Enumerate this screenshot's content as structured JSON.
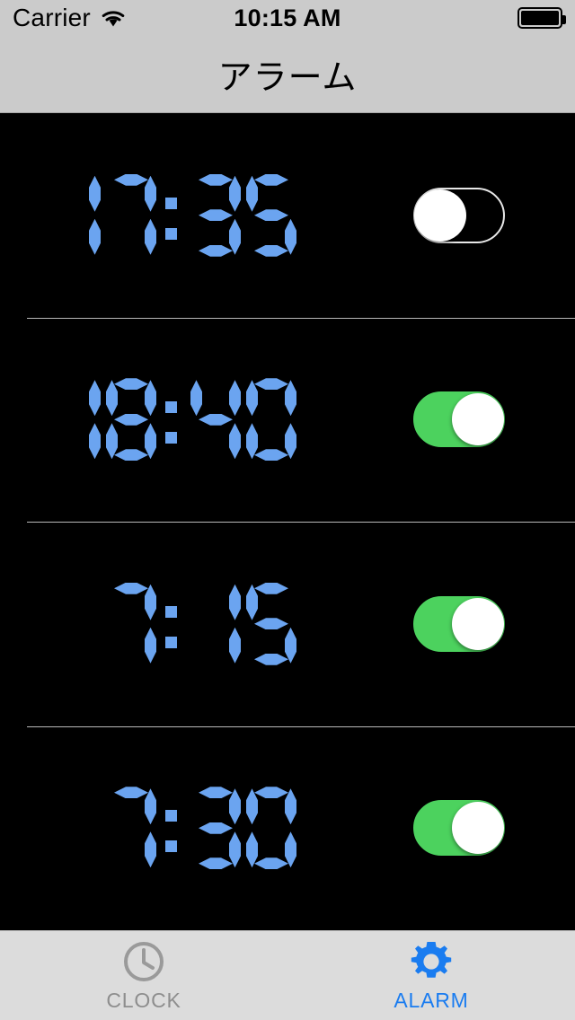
{
  "status_bar": {
    "carrier": "Carrier",
    "wifi_icon": "wifi-icon",
    "time": "10:15 AM",
    "battery_icon": "battery-full-icon"
  },
  "navbar": {
    "title": "アラーム"
  },
  "alarms": [
    {
      "time": "17:35",
      "hour": "17",
      "minute": "35",
      "enabled": false,
      "toggle_state": "off"
    },
    {
      "time": "18:40",
      "hour": "18",
      "minute": "40",
      "enabled": true,
      "toggle_state": "on"
    },
    {
      "time": "7:15",
      "hour": "7",
      "minute": "15",
      "enabled": true,
      "toggle_state": "on"
    },
    {
      "time": "7:30",
      "hour": "7",
      "minute": "30",
      "enabled": true,
      "toggle_state": "on"
    }
  ],
  "tabbar": {
    "tabs": [
      {
        "label": "CLOCK",
        "icon": "clock-icon",
        "active": false
      },
      {
        "label": "ALARM",
        "icon": "gear-icon",
        "active": true
      }
    ]
  },
  "colors": {
    "digit_blue": "#6ba4f0",
    "toggle_on_green": "#4cd25e",
    "accent_blue": "#1a7cf0",
    "inactive_gray": "#8e8e8e",
    "chrome_gray": "#cbcbcb",
    "tabbar_gray": "#dcdcdc",
    "screen_black": "#000000"
  }
}
